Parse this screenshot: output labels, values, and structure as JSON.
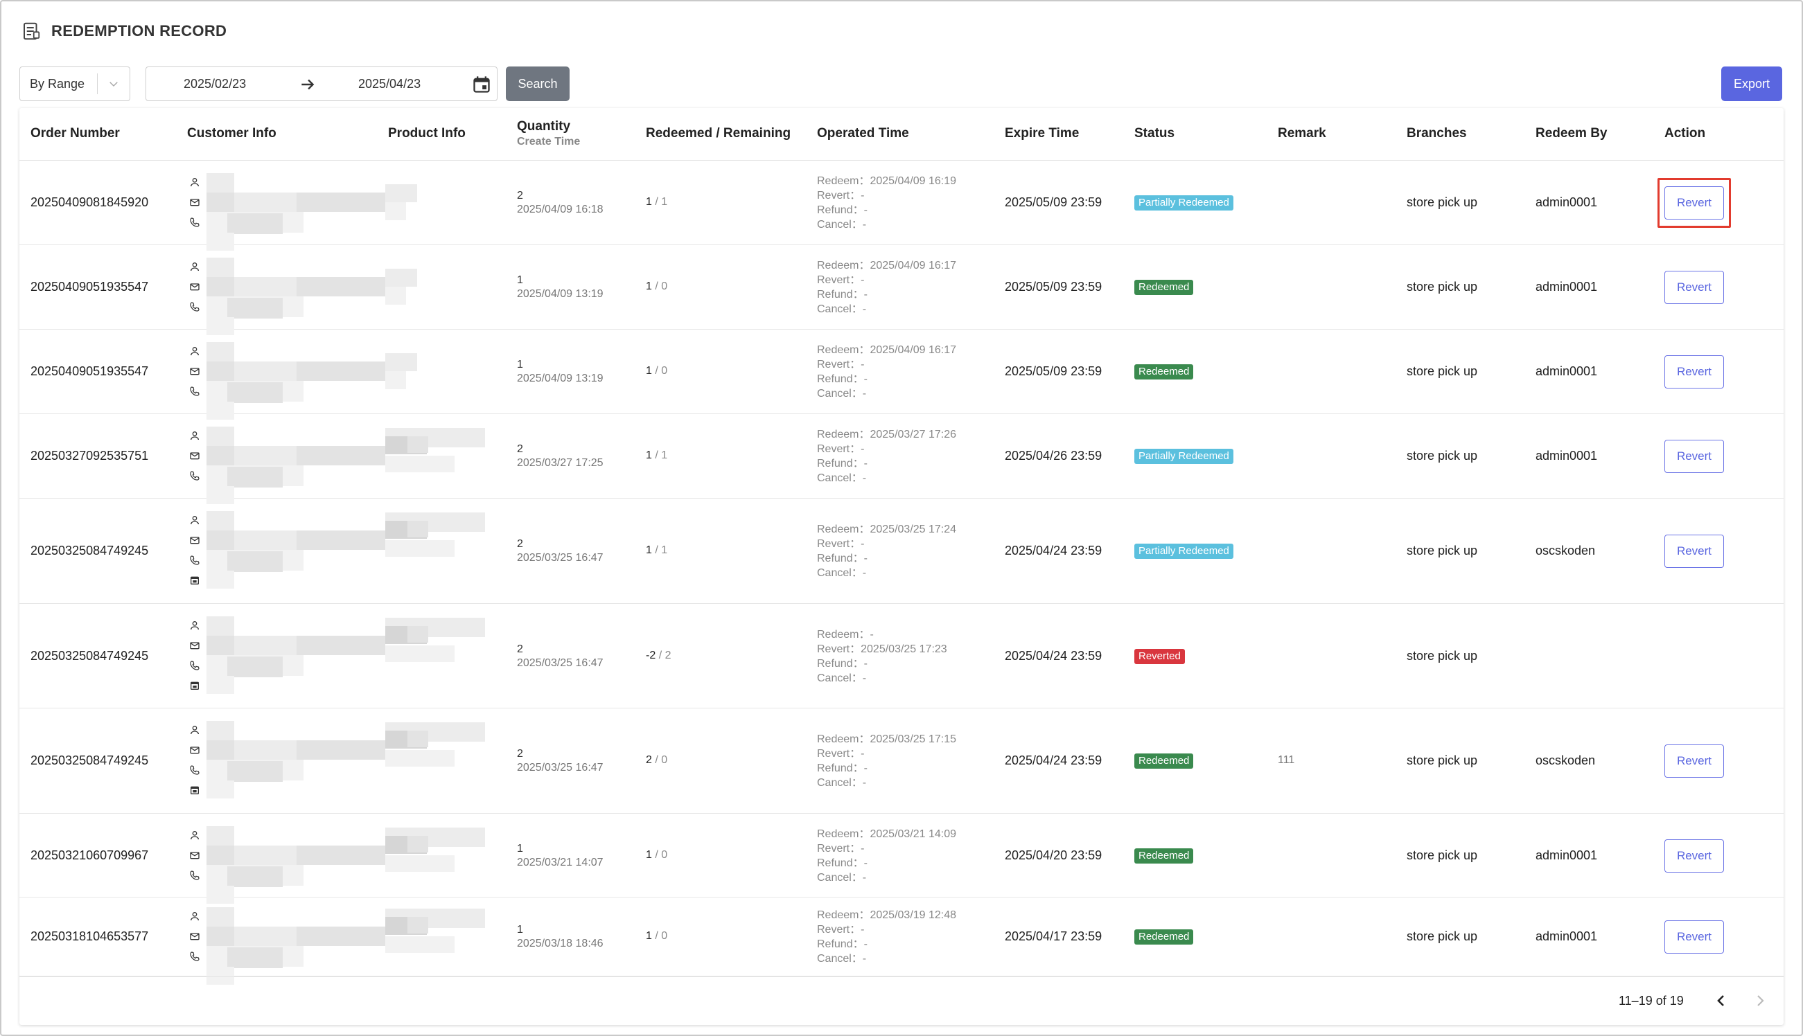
{
  "page": {
    "title": "REDEMPTION RECORD"
  },
  "filters": {
    "range_select": "By Range",
    "date_from": "2025/02/23",
    "date_to": "2025/04/23",
    "search_label": "Search",
    "export_label": "Export"
  },
  "table": {
    "headers": {
      "order_number": "Order Number",
      "customer_info": "Customer Info",
      "product_info": "Product Info",
      "quantity": "Quantity",
      "create_time": "Create Time",
      "redeemed_remaining": "Redeemed / Remaining",
      "operated_time": "Operated Time",
      "expire_time": "Expire Time",
      "status": "Status",
      "remark": "Remark",
      "branches": "Branches",
      "redeem_by": "Redeem By",
      "action": "Action"
    },
    "rows": [
      {
        "order": "20250409081845920",
        "qty": "2",
        "created": "2025/04/09 16:18",
        "redeemed": "1",
        "remaining": "/ 1",
        "redeem": "Redeem：2025/04/09 16:19",
        "revert": "Revert：-",
        "refund": "Refund：-",
        "cancel": "Cancel：-",
        "expire": "2025/05/09 23:59",
        "status": "Partially Redeemed",
        "remark": "",
        "branch": "store pick up",
        "by": "admin0001",
        "action": "Revert"
      },
      {
        "order": "20250409051935547",
        "qty": "1",
        "created": "2025/04/09 13:19",
        "redeemed": "1",
        "remaining": "/ 0",
        "redeem": "Redeem：2025/04/09 16:17",
        "revert": "Revert：-",
        "refund": "Refund：-",
        "cancel": "Cancel：-",
        "expire": "2025/05/09 23:59",
        "status": "Redeemed",
        "remark": "",
        "branch": "store pick up",
        "by": "admin0001",
        "action": "Revert"
      },
      {
        "order": "20250409051935547",
        "qty": "1",
        "created": "2025/04/09 13:19",
        "redeemed": "1",
        "remaining": "/ 0",
        "redeem": "Redeem：2025/04/09 16:17",
        "revert": "Revert：-",
        "refund": "Refund：-",
        "cancel": "Cancel：-",
        "expire": "2025/05/09 23:59",
        "status": "Redeemed",
        "remark": "",
        "branch": "store pick up",
        "by": "admin0001",
        "action": "Revert"
      },
      {
        "order": "20250327092535751",
        "qty": "2",
        "created": "2025/03/27 17:25",
        "redeemed": "1",
        "remaining": "/ 1",
        "redeem": "Redeem：2025/03/27 17:26",
        "revert": "Revert：-",
        "refund": "Refund：-",
        "cancel": "Cancel：-",
        "expire": "2025/04/26 23:59",
        "status": "Partially Redeemed",
        "remark": "",
        "branch": "store pick up",
        "by": "admin0001",
        "action": "Revert"
      },
      {
        "order": "20250325084749245",
        "qty": "2",
        "created": "2025/03/25 16:47",
        "redeemed": "1",
        "remaining": "/ 1",
        "redeem": "Redeem：2025/03/25 17:24",
        "revert": "Revert：-",
        "refund": "Refund：-",
        "cancel": "Cancel：-",
        "expire": "2025/04/24 23:59",
        "status": "Partially Redeemed",
        "remark": "",
        "branch": "store pick up",
        "by": "oscskoden",
        "action": "Revert"
      },
      {
        "order": "20250325084749245",
        "qty": "2",
        "created": "2025/03/25 16:47",
        "redeemed": "-2",
        "remaining": "/ 2",
        "redeem": "Redeem：-",
        "revert": "Revert：2025/03/25 17:23",
        "refund": "Refund：-",
        "cancel": "Cancel：-",
        "expire": "2025/04/24 23:59",
        "status": "Reverted",
        "remark": "",
        "branch": "store pick up",
        "by": "",
        "action": ""
      },
      {
        "order": "20250325084749245",
        "qty": "2",
        "created": "2025/03/25 16:47",
        "redeemed": "2",
        "remaining": "/ 0",
        "redeem": "Redeem：2025/03/25 17:15",
        "revert": "Revert：-",
        "refund": "Refund：-",
        "cancel": "Cancel：-",
        "expire": "2025/04/24 23:59",
        "status": "Redeemed",
        "remark": "111",
        "branch": "store pick up",
        "by": "oscskoden",
        "action": "Revert"
      },
      {
        "order": "20250321060709967",
        "qty": "1",
        "created": "2025/03/21 14:07",
        "redeemed": "1",
        "remaining": "/ 0",
        "redeem": "Redeem：2025/03/21 14:09",
        "revert": "Revert：-",
        "refund": "Refund：-",
        "cancel": "Cancel：-",
        "expire": "2025/04/20 23:59",
        "status": "Redeemed",
        "remark": "",
        "branch": "store pick up",
        "by": "admin0001",
        "action": "Revert"
      },
      {
        "order": "20250318104653577",
        "qty": "1",
        "created": "2025/03/18 18:46",
        "redeemed": "1",
        "remaining": "/ 0",
        "redeem": "Redeem：2025/03/19 12:48",
        "revert": "Revert：-",
        "refund": "Refund：-",
        "cancel": "Cancel：-",
        "expire": "2025/04/17 23:59",
        "status": "Redeemed",
        "remark": "",
        "branch": "store pick up",
        "by": "admin0001",
        "action": "Revert"
      }
    ]
  },
  "pagination": {
    "info": "11–19 of 19"
  },
  "colors": {
    "partially_redeemed": "#5bc0de",
    "redeemed": "#3a8a4e",
    "reverted": "#d9363e",
    "accent": "#5a66e0",
    "highlight": "#e23b2e"
  },
  "icons": [
    "document-list-icon",
    "chevron-down-icon",
    "arrow-right-icon",
    "calendar-icon",
    "person-icon",
    "mail-icon",
    "phone-icon",
    "date-icon",
    "chevron-left-icon",
    "chevron-right-icon"
  ]
}
